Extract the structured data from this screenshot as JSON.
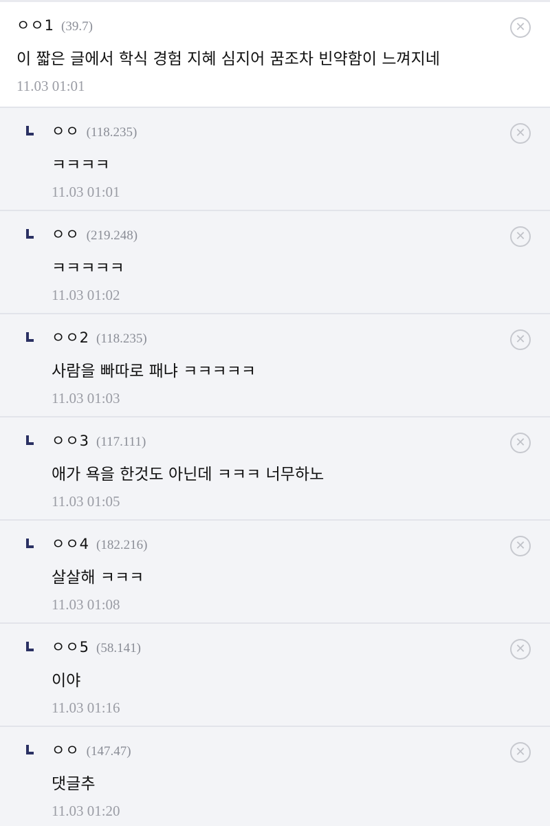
{
  "comments": [
    {
      "nick": "ㅇㅇ1",
      "ip": "(39.7)",
      "text": "이 짧은 글에서 학식 경험 지혜 심지어 꿈조차 빈약함이 느껴지네",
      "time": "11.03 01:01"
    },
    {
      "nick": "ㅇㅇ",
      "ip": "(118.235)",
      "text": "ㅋㅋㅋㅋ",
      "time": "11.03 01:01"
    },
    {
      "nick": "ㅇㅇ",
      "ip": "(219.248)",
      "text": "ㅋㅋㅋㅋㅋ",
      "time": "11.03 01:02"
    },
    {
      "nick": "ㅇㅇ2",
      "ip": "(118.235)",
      "text": "사람을 빠따로 패냐 ㅋㅋㅋㅋㅋ",
      "time": "11.03 01:03"
    },
    {
      "nick": "ㅇㅇ3",
      "ip": "(117.111)",
      "text": "애가 욕을 한것도 아닌데 ㅋㅋㅋ 너무하노",
      "time": "11.03 01:05"
    },
    {
      "nick": "ㅇㅇ4",
      "ip": "(182.216)",
      "text": "살살해 ㅋㅋㅋ",
      "time": "11.03 01:08"
    },
    {
      "nick": "ㅇㅇ5",
      "ip": "(58.141)",
      "text": "이야",
      "time": "11.03 01:16"
    },
    {
      "nick": "ㅇㅇ",
      "ip": "(147.47)",
      "text": "댓글추",
      "time": "11.03 01:20"
    }
  ],
  "icons": {
    "delete": "close-circle-icon",
    "reply": "reply-arrow-icon"
  },
  "colors": {
    "reply_bg": "#f3f4f7",
    "reply_arrow": "#2b3163",
    "meta_text": "#9a9ca4"
  }
}
